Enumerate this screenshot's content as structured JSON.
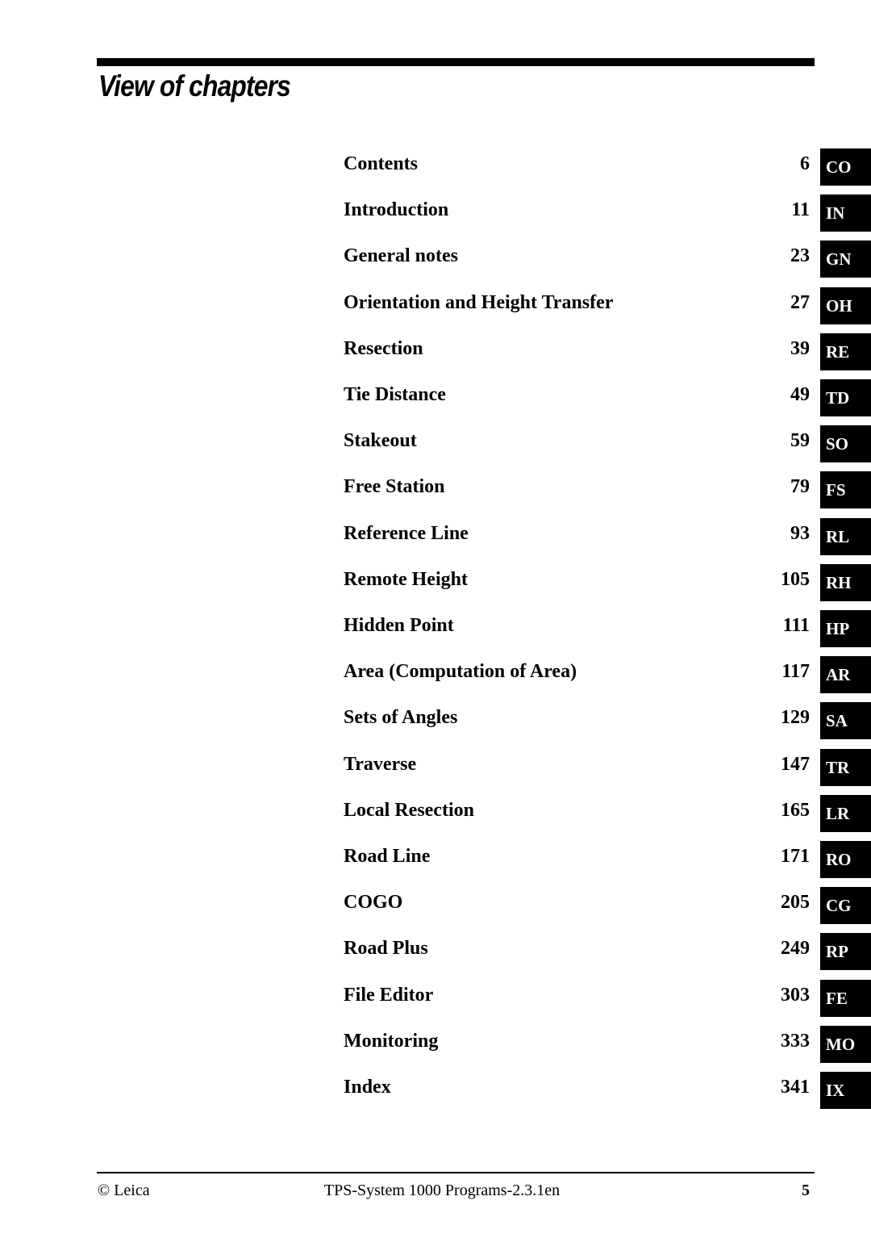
{
  "page_title": "View of chapters",
  "chapters": [
    {
      "label": "Contents",
      "page": "6",
      "tab": "CO"
    },
    {
      "label": "Introduction",
      "page": "11",
      "tab": "IN"
    },
    {
      "label": "General notes",
      "page": "23",
      "tab": "GN"
    },
    {
      "label": "Orientation and Height Transfer",
      "page": "27",
      "tab": "OH"
    },
    {
      "label": "Resection",
      "page": "39",
      "tab": "RE"
    },
    {
      "label": "Tie Distance",
      "page": "49",
      "tab": "TD"
    },
    {
      "label": "Stakeout",
      "page": "59",
      "tab": "SO"
    },
    {
      "label": "Free Station",
      "page": "79",
      "tab": "FS"
    },
    {
      "label": "Reference Line",
      "page": "93",
      "tab": "RL"
    },
    {
      "label": "Remote Height",
      "page": "105",
      "tab": "RH"
    },
    {
      "label": "Hidden Point",
      "page": "111",
      "tab": "HP"
    },
    {
      "label": "Area (Computation of Area)",
      "page": "117",
      "tab": "AR"
    },
    {
      "label": "Sets of Angles",
      "page": "129",
      "tab": "SA"
    },
    {
      "label": "Traverse",
      "page": "147",
      "tab": "TR"
    },
    {
      "label": "Local Resection",
      "page": "165",
      "tab": "LR"
    },
    {
      "label": "Road Line",
      "page": "171",
      "tab": "RO"
    },
    {
      "label": "COGO",
      "page": "205",
      "tab": "CG"
    },
    {
      "label": "Road Plus",
      "page": "249",
      "tab": "RP"
    },
    {
      "label": "File Editor",
      "page": "303",
      "tab": "FE"
    },
    {
      "label": "Monitoring",
      "page": "333",
      "tab": "MO"
    },
    {
      "label": "Index",
      "page": "341",
      "tab": "IX"
    }
  ],
  "footer": {
    "left": "© Leica",
    "center": "TPS-System 1000 Programs-2.3.1en",
    "page_number": "5"
  }
}
